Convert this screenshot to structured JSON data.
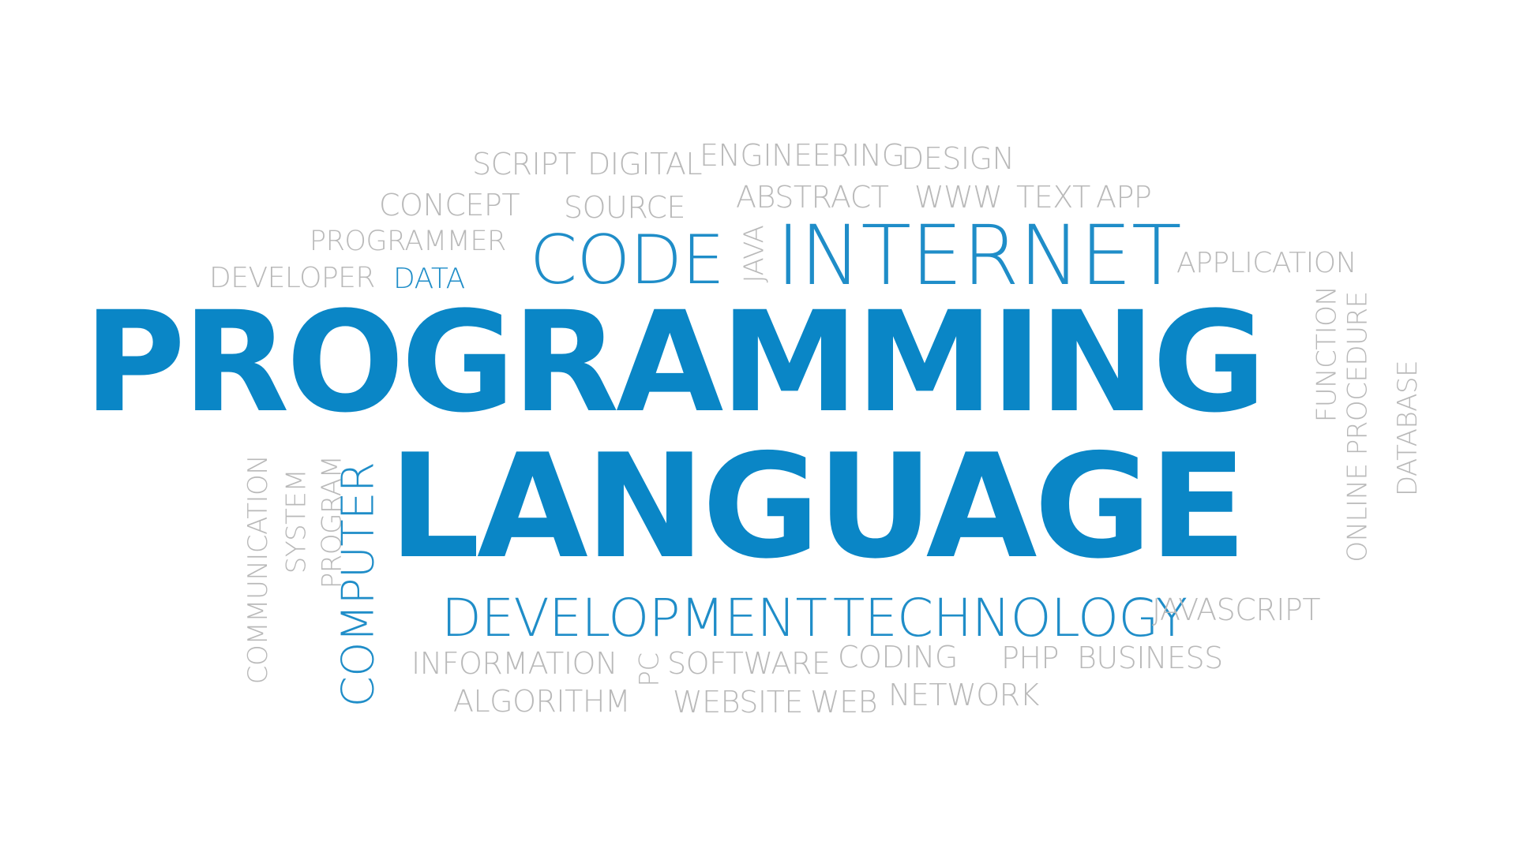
{
  "colors": {
    "primary_blue": "#0a86c6",
    "secondary_blue": "#1f8dc8",
    "gray": "#b9b9b9",
    "background": "#ffffff"
  },
  "words": {
    "programming": "PROGRAMMING",
    "language": "LANGUAGE",
    "internet": "INTERNET",
    "code": "CODE",
    "development": "DEVELOPMENT",
    "technology": "TECHNOLOGY",
    "computer": "COMPUTER",
    "data": "DATA",
    "script": "SCRIPT",
    "digital": "DIGITAL",
    "engineering": "ENGINEERING",
    "design": "DESIGN",
    "concept": "CONCEPT",
    "source": "SOURCE",
    "abstract": "ABSTRACT",
    "www": "WWW",
    "text": "TEXT",
    "app": "APP",
    "programmer": "PROGRAMMER",
    "developer": "DEVELOPER",
    "java": "JAVA",
    "application": "APPLICATION",
    "function": "FUNCTION",
    "procedure": "PROCEDURE",
    "online": "ONLINE",
    "database": "DATABASE",
    "communication": "COMMUNICATION",
    "system": "SYSTEM",
    "program": "PROGRAM",
    "javascript": "JAVASCRIPT",
    "information": "INFORMATION",
    "pc": "PC",
    "software": "SOFTWARE",
    "coding": "CODING",
    "php": "PHP",
    "business": "BUSINESS",
    "algorithm": "ALGORITHM",
    "website": "WEBSITE",
    "web": "WEB",
    "network": "NETWORK"
  }
}
